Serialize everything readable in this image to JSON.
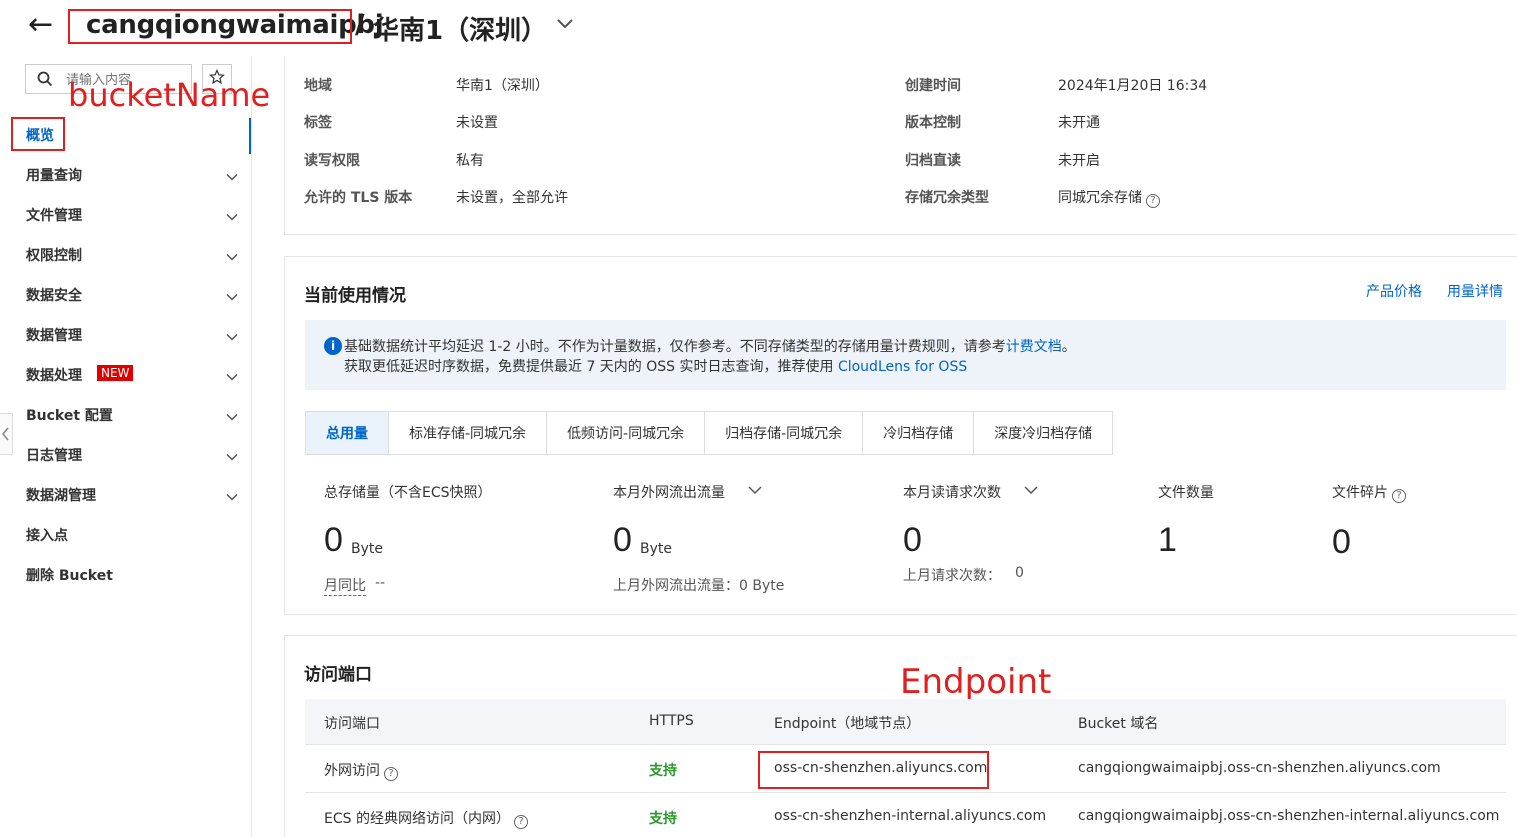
{
  "header": {
    "bucket_name": "cangqiongwaimaipbj",
    "separator": "/",
    "region": "华南1（深圳）"
  },
  "sidebar": {
    "search_placeholder": "请输入内容",
    "annotation": "bucketName",
    "items": [
      {
        "label": "概览",
        "active": true,
        "chevron": false
      },
      {
        "label": "用量查询",
        "chevron": true
      },
      {
        "label": "文件管理",
        "chevron": true
      },
      {
        "label": "权限控制",
        "chevron": true
      },
      {
        "label": "数据安全",
        "chevron": true
      },
      {
        "label": "数据管理",
        "chevron": true
      },
      {
        "label": "数据处理",
        "badge": "NEW",
        "chevron": true
      },
      {
        "label": "Bucket 配置",
        "chevron": true
      },
      {
        "label": "日志管理",
        "chevron": true
      },
      {
        "label": "数据湖管理",
        "chevron": true
      },
      {
        "label": "接入点",
        "chevron": false
      },
      {
        "label": "删除 Bucket",
        "chevron": false
      }
    ]
  },
  "basic_info": {
    "left": [
      {
        "label": "地域",
        "value": "华南1（深圳）"
      },
      {
        "label": "标签",
        "value": "未设置"
      },
      {
        "label": "读写权限",
        "value": "私有"
      },
      {
        "label": "允许的 TLS 版本",
        "value": "未设置，全部允许"
      }
    ],
    "right": [
      {
        "label": "创建时间",
        "value": "2024年1月20日 16:34"
      },
      {
        "label": "版本控制",
        "value": "未开通"
      },
      {
        "label": "归档直读",
        "value": "未开启"
      },
      {
        "label": "存储冗余类型",
        "value": "同城冗余存储"
      }
    ]
  },
  "usage": {
    "title": "当前使用情况",
    "links": [
      "产品价格",
      "用量详情"
    ],
    "banner_line1": "基础数据统计平均延迟 1-2 小时。不作为计量数据，仅作参考。不同存储类型的存储用量计费规则，请参考",
    "banner_link1": "计费文档",
    "banner_line1_end": "。",
    "banner_line2": "获取更低延迟时序数据，免费提供最近 7 天内的 OSS 实时日志查询，推荐使用 ",
    "banner_link2": "CloudLens for OSS",
    "tabs": [
      "总用量",
      "标准存储-同城冗余",
      "低频访问-同城冗余",
      "归档存储-同城冗余",
      "冷归档存储",
      "深度冷归档存储"
    ],
    "active_tab": 0,
    "metrics": {
      "storage_label": "总存储量（不含ECS快照）",
      "storage_value": "0",
      "storage_unit": "Byte",
      "storage_sub": "月同比",
      "storage_sub_value": "--",
      "traffic_label": "本月外网流出流量",
      "traffic_value": "0",
      "traffic_unit": "Byte",
      "traffic_sub": "上月外网流出流量：0 Byte",
      "requests_label": "本月读请求次数",
      "requests_value": "0",
      "requests_sub": "上月请求次数：",
      "requests_sub_value": "0",
      "files_label": "文件数量",
      "files_value": "1",
      "fragments_label": "文件碎片",
      "fragments_value": "0"
    }
  },
  "access": {
    "title": "访问端口",
    "annotation": "Endpoint",
    "columns": [
      "访问端口",
      "HTTPS",
      "Endpoint（地域节点）",
      "Bucket 域名"
    ],
    "rows": [
      {
        "port": "外网访问",
        "https": "支持",
        "endpoint": "oss-cn-shenzhen.aliyuncs.com",
        "domain": "cangqiongwaimaipbj.oss-cn-shenzhen.aliyuncs.com"
      },
      {
        "port": "ECS 的经典网络访问（内网）",
        "https": "支持",
        "endpoint": "oss-cn-shenzhen-internal.aliyuncs.com",
        "domain": "cangqiongwaimaipbj.oss-cn-shenzhen-internal.aliyuncs.com"
      }
    ]
  },
  "colors": {
    "accent": "#0064c8",
    "annotation": "#e02020",
    "success": "#2a9a2a"
  }
}
